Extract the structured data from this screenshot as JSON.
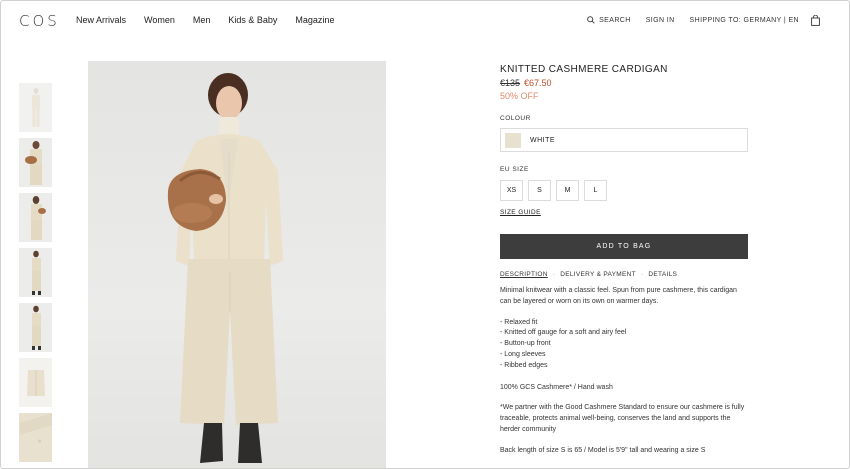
{
  "brand": {
    "logo": "COS"
  },
  "nav": {
    "items": [
      "New Arrivals",
      "Women",
      "Men",
      "Kids & Baby",
      "Magazine"
    ]
  },
  "utility": {
    "search": "SEARCH",
    "sign_in": "SIGN IN",
    "shipping": "SHIPPING TO: GERMANY | EN",
    "bag_icon": "shopping-bag-icon"
  },
  "product": {
    "title": "KNITTED CASHMERE CARDIGAN",
    "old_price": "€135",
    "new_price": "€67.50",
    "discount": "50% OFF",
    "colour_label": "COLOUR",
    "colour_name": "WHITE",
    "colour_swatch": "#e9e1cf",
    "size_label": "EU SIZE",
    "sizes": [
      "XS",
      "S",
      "M",
      "L"
    ],
    "size_guide": "SIZE GUIDE",
    "add_to_bag": "ADD TO BAG"
  },
  "tabs": [
    "DESCRIPTION",
    "DELIVERY & PAYMENT",
    "DETAILS"
  ],
  "description": {
    "intro": "Minimal knitwear with a classic feel. Spun from pure cashmere, this cardigan can be layered or worn on its own on warmer days.",
    "features": [
      "- Relaxed fit",
      "- Knitted off gauge for a soft and airy feel",
      "- Button-up front",
      "- Long sleeves",
      "- Ribbed edges"
    ],
    "composition": "100% GCS Cashmere* / Hand wash",
    "note": "*We partner with the Good Cashmere Standard to ensure our cashmere is fully traceable, protects animal well-being, conserves the land and supports the herder community",
    "fit": "Back length of size S is 65 / Model is 5'9\" tall and wearing a size S"
  },
  "colors": {
    "accent_sale": "#c0502d",
    "discount": "#e08a6a",
    "button": "#3d3d3d"
  }
}
